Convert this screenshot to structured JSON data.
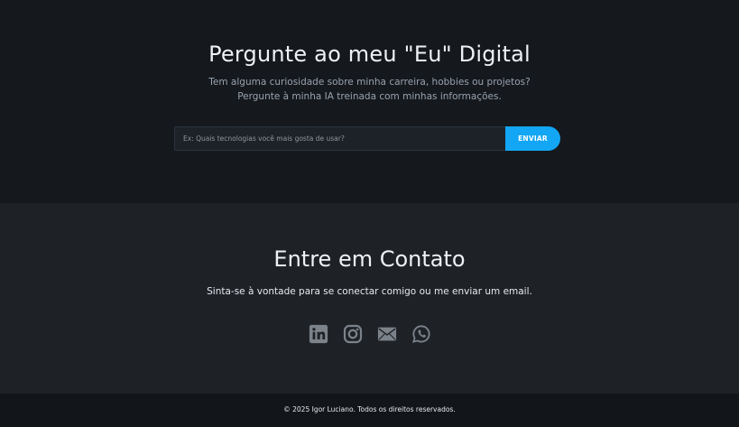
{
  "ask": {
    "title": "Pergunte ao meu \"Eu\" Digital",
    "subtitle_line1": "Tem alguma curiosidade sobre minha carreira, hobbies ou projetos?",
    "subtitle_line2": "Pergunte à minha IA treinada com minhas informações.",
    "input_value": "",
    "input_placeholder": "Ex: Quais tecnologias você mais gosta de usar?",
    "button_label": "ENVIAR",
    "accent_color": "#12a6f4"
  },
  "contact": {
    "title": "Entre em Contato",
    "text": "Sinta-se à vontade para se conectar comigo ou me enviar um email.",
    "socials": [
      {
        "icon": "linkedin-icon"
      },
      {
        "icon": "instagram-icon"
      },
      {
        "icon": "email-icon"
      },
      {
        "icon": "whatsapp-icon"
      }
    ]
  },
  "footer": {
    "text": "© 2025 Igor Luciano. Todos os direitos reservados."
  }
}
